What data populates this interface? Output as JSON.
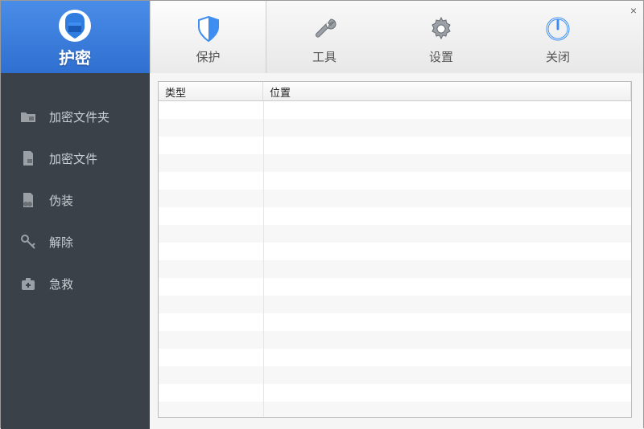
{
  "toolbar": {
    "primary_label": "护密",
    "tabs": [
      {
        "id": "protect",
        "label": "保护"
      },
      {
        "id": "tools",
        "label": "工具"
      },
      {
        "id": "settings",
        "label": "设置"
      },
      {
        "id": "close",
        "label": "关闭"
      }
    ]
  },
  "sidebar": {
    "items": [
      {
        "id": "encrypt-folder",
        "label": "加密文件夹"
      },
      {
        "id": "encrypt-file",
        "label": "加密文件"
      },
      {
        "id": "disguise",
        "label": "伪装"
      },
      {
        "id": "remove",
        "label": "解除"
      },
      {
        "id": "rescue",
        "label": "急救"
      }
    ]
  },
  "table": {
    "columns": [
      {
        "id": "type",
        "label": "类型"
      },
      {
        "id": "location",
        "label": "位置"
      }
    ],
    "rows": []
  }
}
